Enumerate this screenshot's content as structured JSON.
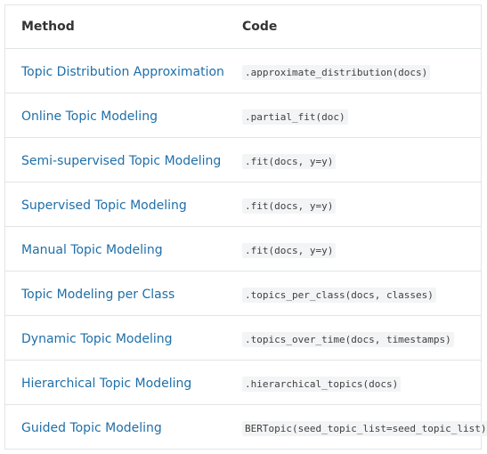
{
  "table": {
    "headers": {
      "method": "Method",
      "code": "Code"
    },
    "rows": [
      {
        "method": "Topic Distribution Approximation",
        "code": ".approximate_distribution(docs)"
      },
      {
        "method": "Online Topic Modeling",
        "code": ".partial_fit(doc)"
      },
      {
        "method": "Semi-supervised Topic Modeling",
        "code": ".fit(docs, y=y)"
      },
      {
        "method": "Supervised Topic Modeling",
        "code": ".fit(docs, y=y)"
      },
      {
        "method": "Manual Topic Modeling",
        "code": ".fit(docs, y=y)"
      },
      {
        "method": "Topic Modeling per Class",
        "code": ".topics_per_class(docs, classes)"
      },
      {
        "method": "Dynamic Topic Modeling",
        "code": ".topics_over_time(docs, timestamps)"
      },
      {
        "method": "Hierarchical Topic Modeling",
        "code": ".hierarchical_topics(docs)"
      },
      {
        "method": "Guided Topic Modeling",
        "code": "BERTopic(seed_topic_list=seed_topic_list)"
      }
    ]
  },
  "colors": {
    "link": "#1f6fa8",
    "border": "#e1e4e5",
    "code_bg": "#f3f4f5"
  }
}
